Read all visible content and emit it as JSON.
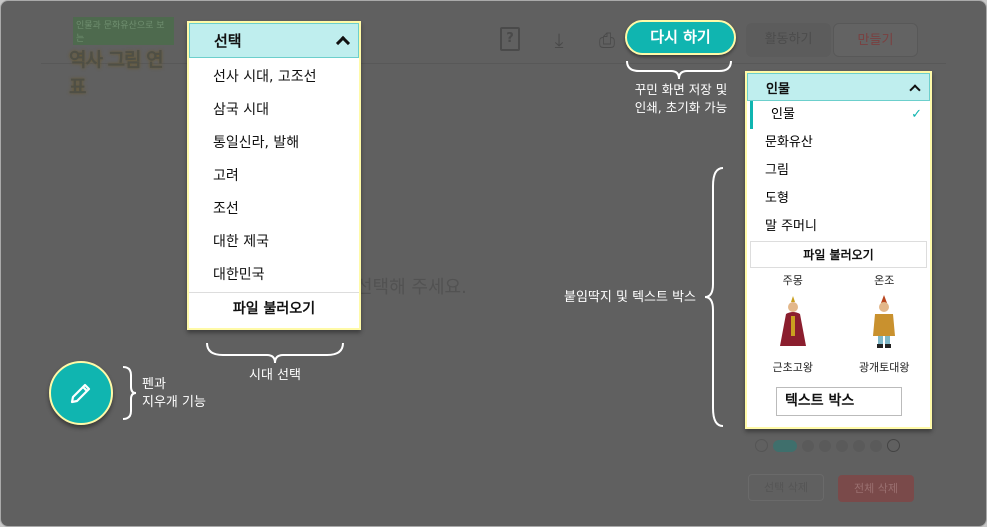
{
  "logo": {
    "subtitle": "인물과 문화유산으로 보는",
    "title": "역사 그림 연표"
  },
  "toolbar": {
    "help_icon": "help-book-icon",
    "download_icon": "download-icon",
    "print_icon": "print-icon",
    "redo_label": "다시 하기",
    "activity_tab": "활동하기",
    "make_tab": "만들기"
  },
  "era_dropdown": {
    "selected": "선택",
    "options": [
      "선사 시대, 고조선",
      "삼국 시대",
      "통일신라, 발해",
      "고려",
      "조선",
      "대한 제국",
      "대한민국"
    ],
    "load_file": "파일 불러오기"
  },
  "canvas": {
    "placeholder": "선택해 주세요."
  },
  "sticker_dropdown": {
    "selected": "인물",
    "options": [
      "인물",
      "문화유산",
      "그림",
      "도형",
      "말 주머니"
    ],
    "checked_index": 0,
    "load_file": "파일 불러오기",
    "stickers": [
      {
        "top_label": "주몽",
        "name": "근초고왕"
      },
      {
        "top_label": "온조",
        "name": "광개토대왕"
      }
    ],
    "text_box": "텍스트 박스"
  },
  "pagination": {
    "pages": 6,
    "current": 1
  },
  "bottom_buttons": {
    "delete_selected": "선택 삭제",
    "delete_all": "전체 삭제"
  },
  "annotations": {
    "save_print_reset": "꾸민 화면 저장 및\n인쇄, 초기화 가능",
    "era_select": "시대 선택",
    "pen_eraser": "펜과\n지우개 기능",
    "sticker_textbox": "붙임딱지 및 텍스트 박스"
  },
  "colors": {
    "accent": "#10b5b0",
    "highlight_border": "#fffaa8",
    "dropdown_header": "#bfeeee",
    "delete_all": "#c94a4a"
  }
}
